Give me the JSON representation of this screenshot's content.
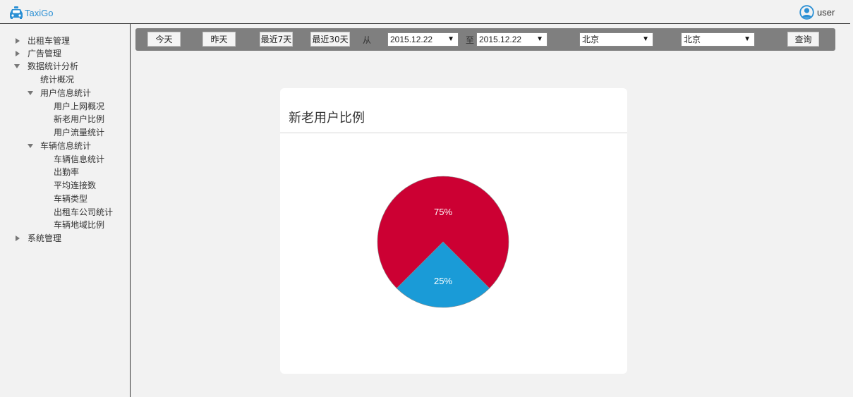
{
  "app": {
    "logo_text": "TaxiGo",
    "logo_icon": "taxi-icon",
    "brand_color": "#2a8fd4"
  },
  "user": {
    "name": "user",
    "icon": "user-circle-icon"
  },
  "sidebar": {
    "items": [
      {
        "label": "出租车管理",
        "state": "collapsed"
      },
      {
        "label": "广告管理",
        "state": "collapsed"
      },
      {
        "label": "数据统计分析",
        "state": "expanded"
      },
      {
        "label": "统计概况"
      },
      {
        "label": "用户信息统计",
        "state": "expanded"
      },
      {
        "label": "用户上网概况"
      },
      {
        "label": "新老用户比例"
      },
      {
        "label": "用户流量统计"
      },
      {
        "label": "车辆信息统计",
        "state": "expanded"
      },
      {
        "label": "车辆信息统计"
      },
      {
        "label": "出勤率"
      },
      {
        "label": "平均连接数"
      },
      {
        "label": "车辆类型"
      },
      {
        "label": "出租车公司统计"
      },
      {
        "label": "车辆地域比例"
      },
      {
        "label": "系统管理",
        "state": "collapsed"
      }
    ]
  },
  "filter": {
    "today": "今天",
    "yesterday": "昨天",
    "last7": "最近7天",
    "last30": "最近30天",
    "from_label": "从",
    "to_label": "至",
    "start_date": "2015.12.22",
    "end_date": "2015.12.22",
    "select_arrow": "▼",
    "city1": "北京",
    "city2": "北京",
    "query": "查询"
  },
  "card": {
    "title": "新老用户比例"
  },
  "chart_data": {
    "type": "pie",
    "title": "新老用户比例",
    "slices": [
      {
        "value": 75,
        "label": "75%",
        "color": "#cc0033"
      },
      {
        "value": 25,
        "label": "25%",
        "color": "#1a9bd7"
      }
    ]
  }
}
